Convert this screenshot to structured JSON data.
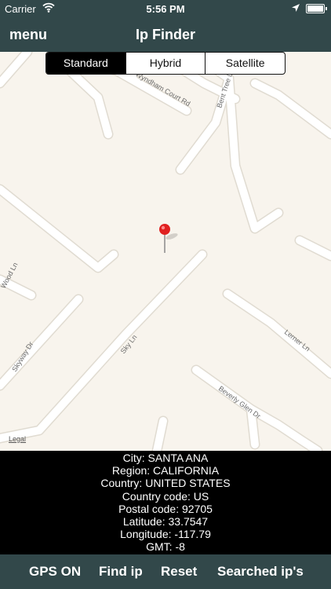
{
  "status_bar": {
    "carrier": "Carrier",
    "time": "5:56 PM"
  },
  "nav_bar": {
    "menu_label": "menu",
    "title": "Ip Finder"
  },
  "map": {
    "segments": [
      {
        "label": "Standard",
        "selected": true
      },
      {
        "label": "Hybrid",
        "selected": false
      },
      {
        "label": "Satellite",
        "selected": false
      }
    ],
    "street_labels": {
      "wyndham": "Wyndham Court Rd",
      "bent_tree": "Bent Tree Ln",
      "wood": "Wood Ln",
      "skyway": "Skyway Dr",
      "sky": "Sky Ln",
      "lerner": "Lerner Ln",
      "beverly": "Beverly Glen Dr"
    },
    "legal": "Legal",
    "pin_color": "#e02020"
  },
  "info": {
    "city": "City: SANTA ANA",
    "region": "Region: CALIFORNIA",
    "country": "Country: UNITED STATES",
    "country_code": "Country code: US",
    "postal_code": "Postal code: 92705",
    "latitude": "Latitude: 33.7547",
    "longitude": "Longitude: -117.79",
    "gmt": "GMT: -8"
  },
  "toolbar": {
    "gps": "GPS ON",
    "find": "Find ip",
    "reset": "Reset",
    "searched": "Searched ip's"
  },
  "colors": {
    "bar": "#32484a",
    "map_bg": "#f8f4ed",
    "road": "#ffffff"
  }
}
